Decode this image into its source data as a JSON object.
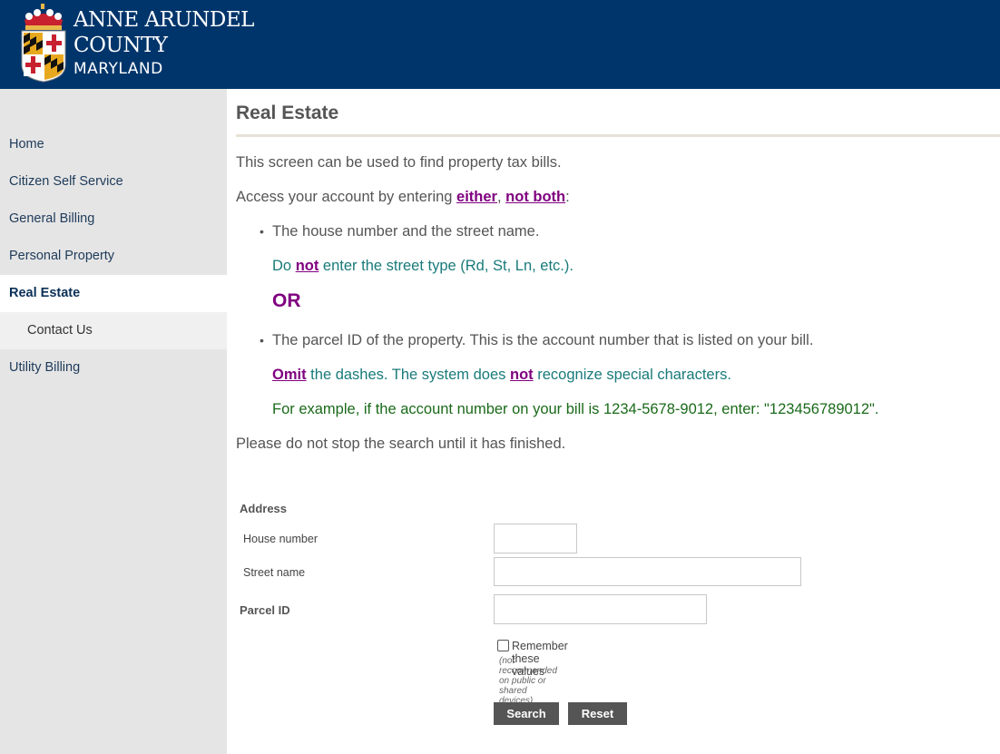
{
  "header": {
    "logo_line1": "ANNE ARUNDEL",
    "logo_line2": "COUNTY",
    "logo_line3": "MARYLAND",
    "brand_color": "#00356b"
  },
  "sidebar": {
    "items": [
      {
        "label": "Home"
      },
      {
        "label": "Citizen Self Service"
      },
      {
        "label": "General Billing"
      },
      {
        "label": "Personal Property"
      },
      {
        "label": "Real Estate",
        "active": true
      },
      {
        "label": "Contact Us",
        "sub": true
      },
      {
        "label": "Utility Billing"
      }
    ]
  },
  "main": {
    "title": "Real Estate",
    "intro": "This screen can be used to find property tax bills.",
    "access_prefix": "Access your account by entering ",
    "access_either": "either",
    "access_comma": ", ",
    "access_notboth": "not both",
    "access_suffix": ":",
    "bullet1": "The house number and the street name.",
    "note1_do": "Do ",
    "note1_not": "not",
    "note1_rest": " enter the street type (Rd, St, Ln, etc.).",
    "or_label": "OR",
    "bullet2": "The parcel ID of the property. This is the account number that is listed on your bill.",
    "note2_omit": "Omit",
    "note2_mid": " the dashes. The system does ",
    "note2_not": "not",
    "note2_rest": " recognize special characters.",
    "example": "For example, if the account number on your bill is 1234-5678-9012, enter: \"123456789012\".",
    "wait": "Please do not stop the search until it has finished."
  },
  "form": {
    "address_label": "Address",
    "house_number_label": "House number",
    "house_number_value": "",
    "street_name_label": "Street name",
    "street_name_value": "",
    "parcel_id_label": "Parcel ID",
    "parcel_id_value": "",
    "remember_label": "Remember these values",
    "remember_checked": false,
    "remember_note": "(not recommended on public or shared devices)",
    "search_label": "Search",
    "reset_label": "Reset"
  }
}
